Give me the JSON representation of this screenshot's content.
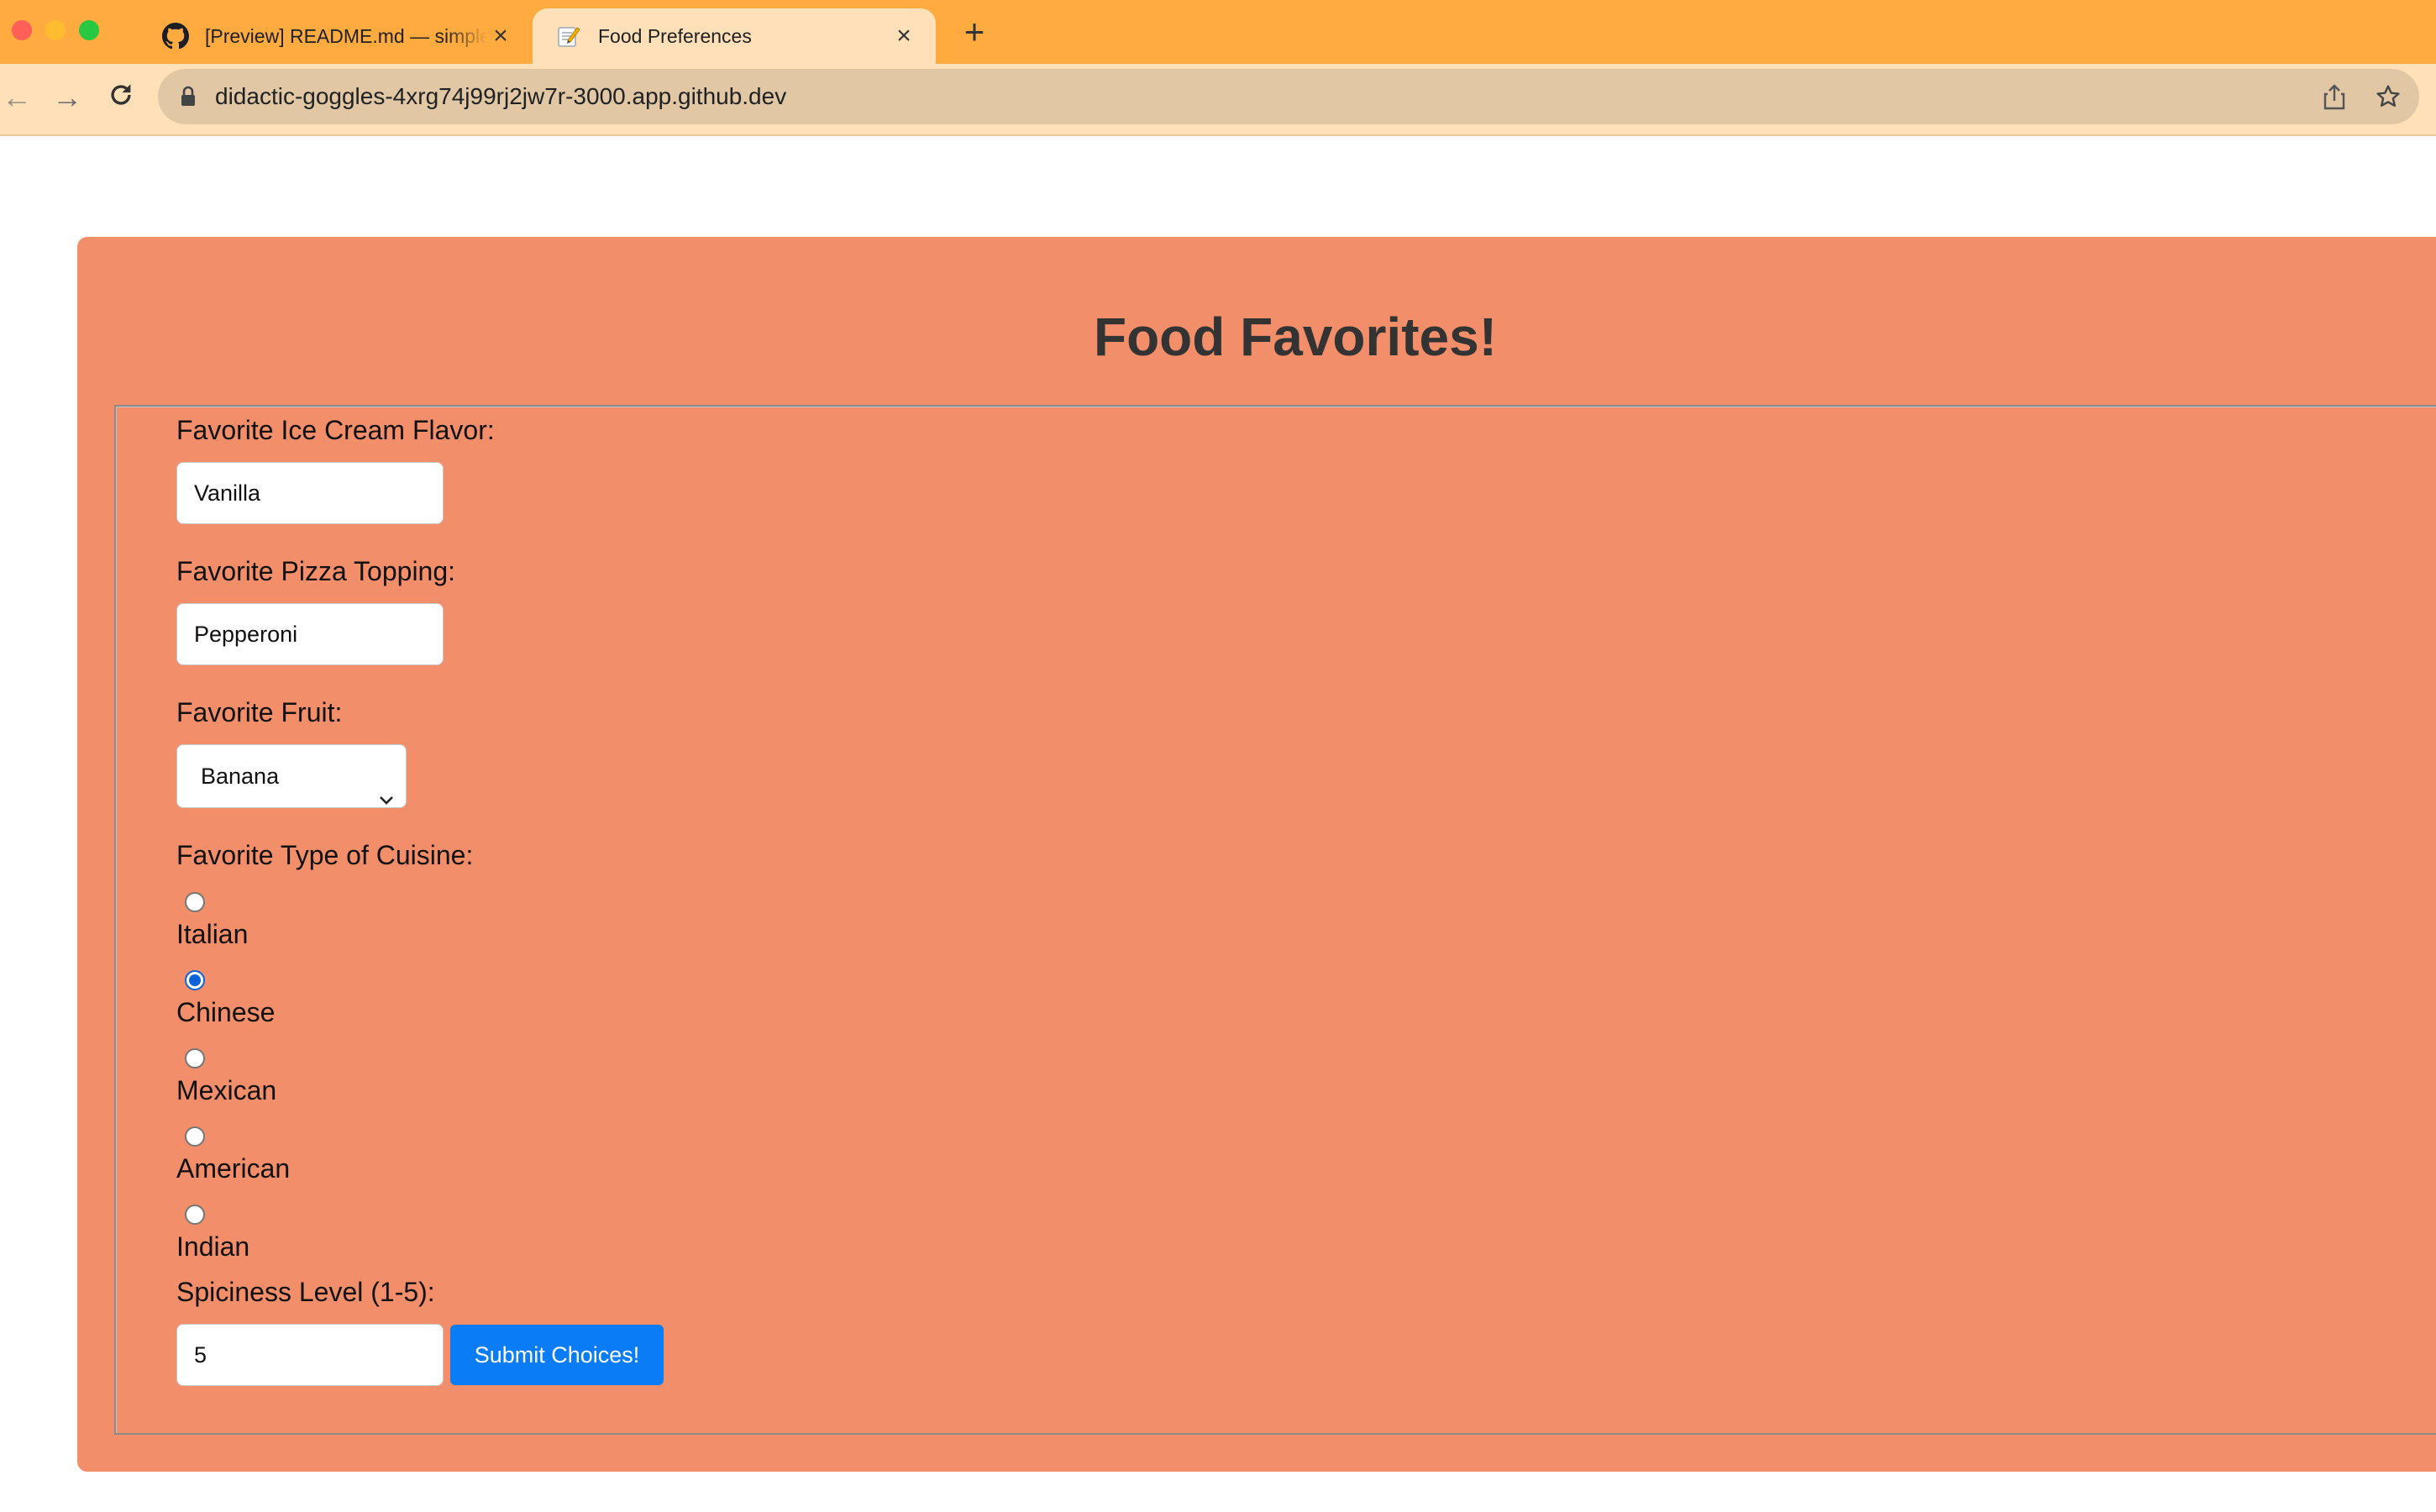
{
  "browser": {
    "tabs": [
      {
        "title": "[Preview] README.md — simple-form",
        "favicon": "github-icon",
        "active": false
      },
      {
        "title": "Food Preferences",
        "favicon": "memo-icon",
        "active": true
      }
    ],
    "url": "didactic-goggles-4xrg74j99rj2jw7r-3000.app.github.dev",
    "colors": {
      "tabstrip": "#ffab40",
      "toolbar": "#ffe0b8",
      "omnibox": "#e1c7a4"
    }
  },
  "page": {
    "title": "Food Favorites!",
    "background": "#f28e69",
    "form": {
      "ice_cream": {
        "label": "Favorite Ice Cream Flavor:",
        "value": "Vanilla"
      },
      "pizza": {
        "label": "Favorite Pizza Topping:",
        "value": "Pepperoni"
      },
      "fruit": {
        "label": "Favorite Fruit:",
        "selected": "Banana"
      },
      "cuisine": {
        "label": "Favorite Type of Cuisine:",
        "options": [
          "Italian",
          "Chinese",
          "Mexican",
          "American",
          "Indian"
        ],
        "selected": "Chinese"
      },
      "spiciness": {
        "label": "Spiciness Level (1-5):",
        "value": "5"
      },
      "submit_label": "Submit Choices!",
      "submit_color": "#0a7cf5"
    }
  }
}
